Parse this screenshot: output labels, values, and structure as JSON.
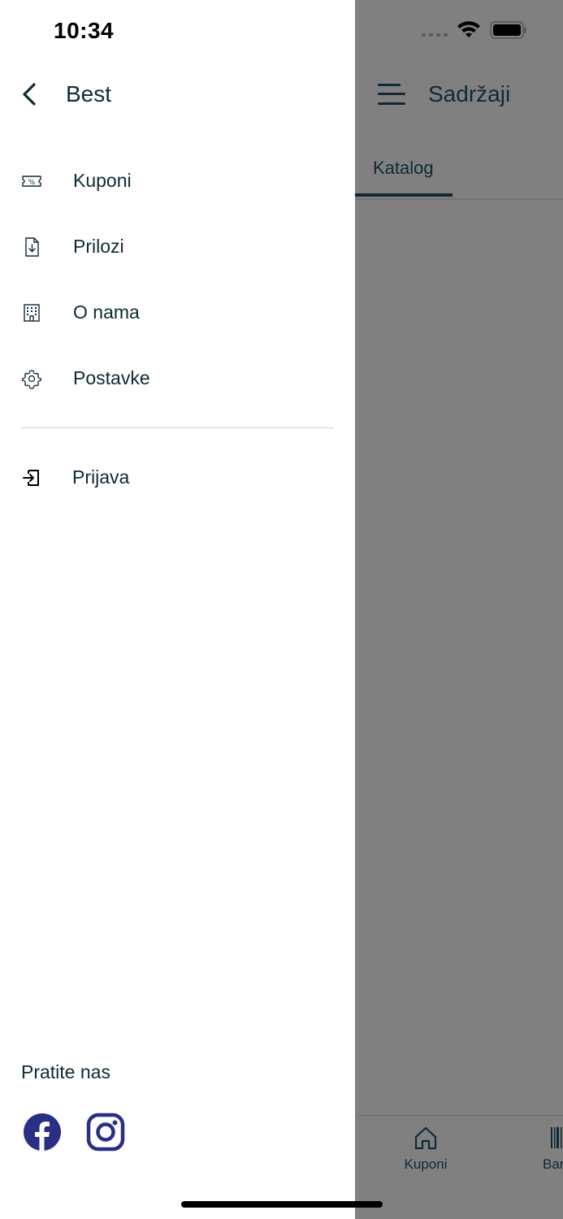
{
  "status_bar": {
    "time": "10:34"
  },
  "background_app": {
    "title": "Sadržaji",
    "tabs": [
      {
        "label": "Katalog",
        "active": true
      }
    ],
    "bottom_tabs": [
      {
        "label": "Kuponi",
        "icon": "home-icon"
      },
      {
        "label": "Bar",
        "icon": "barcode-icon"
      }
    ]
  },
  "drawer": {
    "title": "Best",
    "menu": [
      {
        "label": "Kuponi",
        "icon": "coupon-icon"
      },
      {
        "label": "Prilozi",
        "icon": "file-download-icon"
      },
      {
        "label": "O nama",
        "icon": "building-icon"
      },
      {
        "label": "Postavke",
        "icon": "gear-icon"
      }
    ],
    "login": {
      "label": "Prijava",
      "icon": "login-icon"
    },
    "follow_us": "Pratite nas",
    "social": [
      {
        "icon": "facebook-icon"
      },
      {
        "icon": "instagram-icon"
      }
    ]
  },
  "colors": {
    "text": "#0f2a36",
    "social": "#2a2f86",
    "overlay": "#808080"
  }
}
